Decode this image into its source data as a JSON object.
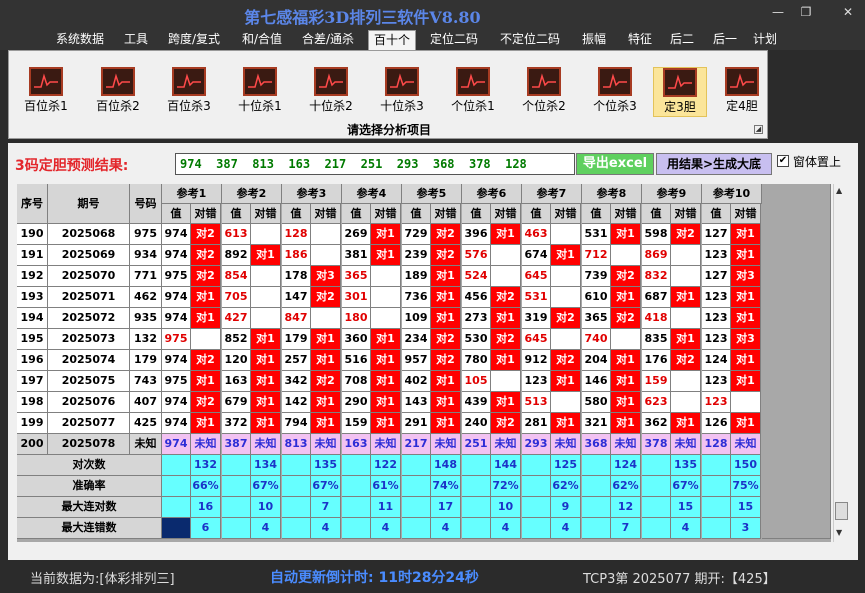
{
  "app": {
    "title": "第七感福彩3D排列三软件V8.80"
  },
  "window": {
    "minimize": "—",
    "restore": "❐",
    "close": "✕"
  },
  "menu": [
    "系统数据",
    "工具",
    "跨度/复式",
    "和/合值",
    "合差/通杀",
    "百十个",
    "定位二码",
    "不定位二码",
    "振幅",
    "特征",
    "后二",
    "后一",
    "计划"
  ],
  "menu_active_index": 5,
  "ribbon": {
    "buttons": [
      "百位杀1",
      "百位杀2",
      "百位杀3",
      "十位杀1",
      "十位杀2",
      "十位杀3",
      "个位杀1",
      "个位杀2",
      "个位杀3",
      "定3胆",
      "定4胆"
    ],
    "active_index": 9,
    "caption": "请选择分析项目",
    "icon": "chart-icon"
  },
  "prediction": {
    "label": "3码定胆预测结果:",
    "value": "974  387  813  163  217  251  293  368  378  128"
  },
  "actions": {
    "export": "导出excel",
    "generate": "用结果>生成大底",
    "ontop": "窗体置上",
    "ontop_checked": true
  },
  "colors": {
    "hit": "#ff0000",
    "hit_text": "#ffffff",
    "miss_text": "#e00000",
    "pending_bg": "#f2c2f2",
    "pending_text": "#2d2dd6",
    "stats_bg": "#66ffff",
    "stats_text": "#1c33c8",
    "header_bg": "#d6d6d6"
  },
  "table": {
    "header_left": [
      "序号",
      "期号",
      "号码"
    ],
    "groups": [
      "参考1",
      "参考2",
      "参考3",
      "参考4",
      "参考5",
      "参考6",
      "参考7",
      "参考8",
      "参考9",
      "参考10"
    ],
    "sub_headers": [
      "值",
      "对错"
    ],
    "rows": [
      {
        "seq": "190",
        "issue": "2025068",
        "num": "975",
        "vals": [
          "974",
          "613",
          "128",
          "269",
          "729",
          "396",
          "463",
          "531",
          "598",
          "127"
        ],
        "marks": [
          "对2",
          "",
          "",
          "对1",
          "对2",
          "对1",
          "",
          "对1",
          "对2",
          "对1"
        ]
      },
      {
        "seq": "191",
        "issue": "2025069",
        "num": "934",
        "vals": [
          "974",
          "892",
          "186",
          "381",
          "239",
          "576",
          "674",
          "712",
          "869",
          "123"
        ],
        "marks": [
          "对2",
          "对1",
          "",
          "对1",
          "对2",
          "",
          "对1",
          "",
          "",
          "对1"
        ]
      },
      {
        "seq": "192",
        "issue": "2025070",
        "num": "771",
        "vals": [
          "975",
          "854",
          "178",
          "365",
          "189",
          "524",
          "645",
          "739",
          "832",
          "127"
        ],
        "marks": [
          "对2",
          "",
          "对3",
          "",
          "对1",
          "",
          "",
          "对2",
          "",
          "对3"
        ]
      },
      {
        "seq": "193",
        "issue": "2025071",
        "num": "462",
        "vals": [
          "974",
          "705",
          "147",
          "301",
          "736",
          "456",
          "531",
          "610",
          "687",
          "123"
        ],
        "marks": [
          "对1",
          "",
          "对2",
          "",
          "对1",
          "对2",
          "",
          "对1",
          "对1",
          "对1"
        ]
      },
      {
        "seq": "194",
        "issue": "2025072",
        "num": "935",
        "vals": [
          "974",
          "427",
          "847",
          "180",
          "109",
          "273",
          "319",
          "365",
          "418",
          "123"
        ],
        "marks": [
          "对1",
          "",
          "",
          "",
          "对1",
          "对1",
          "对2",
          "对2",
          "",
          "对1"
        ]
      },
      {
        "seq": "195",
        "issue": "2025073",
        "num": "132",
        "vals": [
          "975",
          "852",
          "179",
          "360",
          "234",
          "530",
          "645",
          "740",
          "835",
          "123"
        ],
        "marks": [
          "",
          "对1",
          "对1",
          "对1",
          "对2",
          "对2",
          "",
          "",
          "对1",
          "对3"
        ]
      },
      {
        "seq": "196",
        "issue": "2025074",
        "num": "179",
        "vals": [
          "974",
          "120",
          "257",
          "516",
          "957",
          "780",
          "912",
          "204",
          "176",
          "124"
        ],
        "marks": [
          "对2",
          "对1",
          "对1",
          "对1",
          "对2",
          "对1",
          "对2",
          "对1",
          "对2",
          "对1"
        ]
      },
      {
        "seq": "197",
        "issue": "2025075",
        "num": "743",
        "vals": [
          "975",
          "163",
          "342",
          "708",
          "402",
          "105",
          "123",
          "146",
          "159",
          "123"
        ],
        "marks": [
          "对1",
          "对1",
          "对2",
          "对1",
          "对1",
          "",
          "对1",
          "对1",
          "",
          "对1"
        ]
      },
      {
        "seq": "198",
        "issue": "2025076",
        "num": "407",
        "vals": [
          "974",
          "679",
          "142",
          "290",
          "143",
          "439",
          "513",
          "580",
          "623",
          "123"
        ],
        "marks": [
          "对2",
          "对1",
          "对1",
          "对1",
          "对1",
          "对1",
          "",
          "对1",
          "",
          ""
        ]
      },
      {
        "seq": "199",
        "issue": "2025077",
        "num": "425",
        "vals": [
          "974",
          "372",
          "794",
          "159",
          "291",
          "240",
          "281",
          "321",
          "362",
          "126"
        ],
        "marks": [
          "对1",
          "对1",
          "对1",
          "对1",
          "对1",
          "对2",
          "对1",
          "对1",
          "对1",
          "对1"
        ]
      }
    ],
    "pending_row": {
      "seq": "200",
      "issue": "2025078",
      "num": "未知",
      "vals": [
        "974",
        "387",
        "813",
        "163",
        "217",
        "251",
        "293",
        "368",
        "378",
        "128"
      ],
      "mark": "未知"
    },
    "stats": [
      {
        "label": "对次数",
        "values": [
          "132",
          "134",
          "135",
          "122",
          "148",
          "144",
          "125",
          "124",
          "135",
          "150"
        ]
      },
      {
        "label": "准确率",
        "values": [
          "66%",
          "67%",
          "67%",
          "61%",
          "74%",
          "72%",
          "62%",
          "62%",
          "67%",
          "75%"
        ]
      },
      {
        "label": "最大连对数",
        "values": [
          "16",
          "10",
          "7",
          "11",
          "17",
          "10",
          "9",
          "12",
          "15",
          "15"
        ]
      },
      {
        "label": "最大连错数",
        "values": [
          "6",
          "4",
          "4",
          "4",
          "4",
          "4",
          "4",
          "7",
          "4",
          "3"
        ]
      }
    ]
  },
  "status": {
    "source": "当前数据为:[体彩排列三]",
    "countdown": "自动更新倒计时: 11时28分24秒",
    "issue": "TCP3第 2025077 期开:【425】"
  }
}
